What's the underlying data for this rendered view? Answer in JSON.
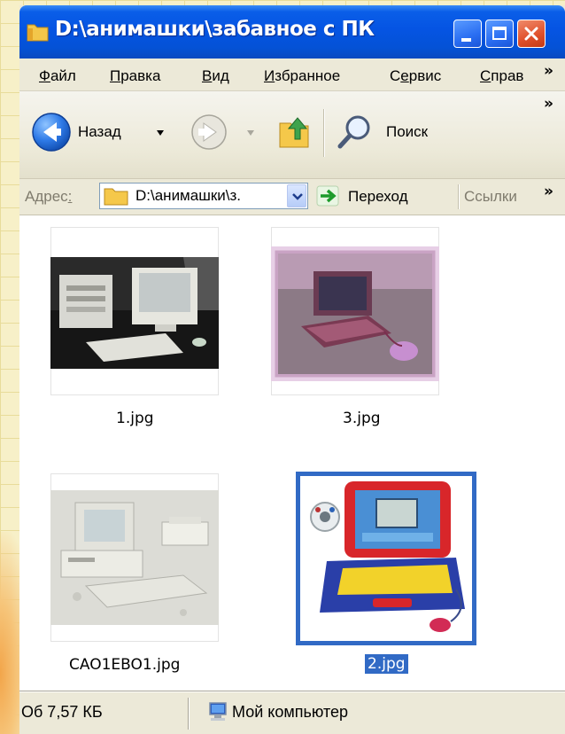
{
  "window": {
    "title": "D:\\анимашки\\забавное с ПК"
  },
  "menu": {
    "items": [
      {
        "label": "Файл",
        "accel": "Ф",
        "rest": "айл"
      },
      {
        "label": "Правка",
        "accel": "П",
        "rest": "равка"
      },
      {
        "label": "Вид",
        "accel": "В",
        "rest": "ид"
      },
      {
        "label": "Избранное",
        "accel": "И",
        "rest": "збранное"
      },
      {
        "label": "Сервис",
        "pre": "С",
        "accel": "е",
        "rest": "рвис"
      },
      {
        "label": "Справка",
        "pre": "",
        "accel": "С",
        "rest": "прав"
      }
    ],
    "overflow": "»"
  },
  "toolbar": {
    "back_label": "Назад",
    "search_label": "Поиск",
    "overflow": "»"
  },
  "address": {
    "label_prefix": "Адрес",
    "label_accel": ":",
    "value": "D:\\анимашки\\з.",
    "go_label": "Переход",
    "links_label": "Ссылки",
    "overflow": "»"
  },
  "files": [
    {
      "name": "1.jpg",
      "selected": false,
      "picture": "desktop-pc-photo"
    },
    {
      "name": "3.jpg",
      "selected": false,
      "picture": "pink-laptop-photo"
    },
    {
      "name": "CAO1EBO1.jpg",
      "selected": false,
      "picture": "beige-pc-photo"
    },
    {
      "name": "2.jpg",
      "selected": true,
      "picture": "toy-laptop-photo"
    }
  ],
  "status": {
    "size_text": "Об 7,57 КБ",
    "zone_text": "Мой компьютер"
  },
  "colors": {
    "titlebar": "#0554e3",
    "selection": "#316ac5",
    "chrome": "#ece9d8"
  }
}
